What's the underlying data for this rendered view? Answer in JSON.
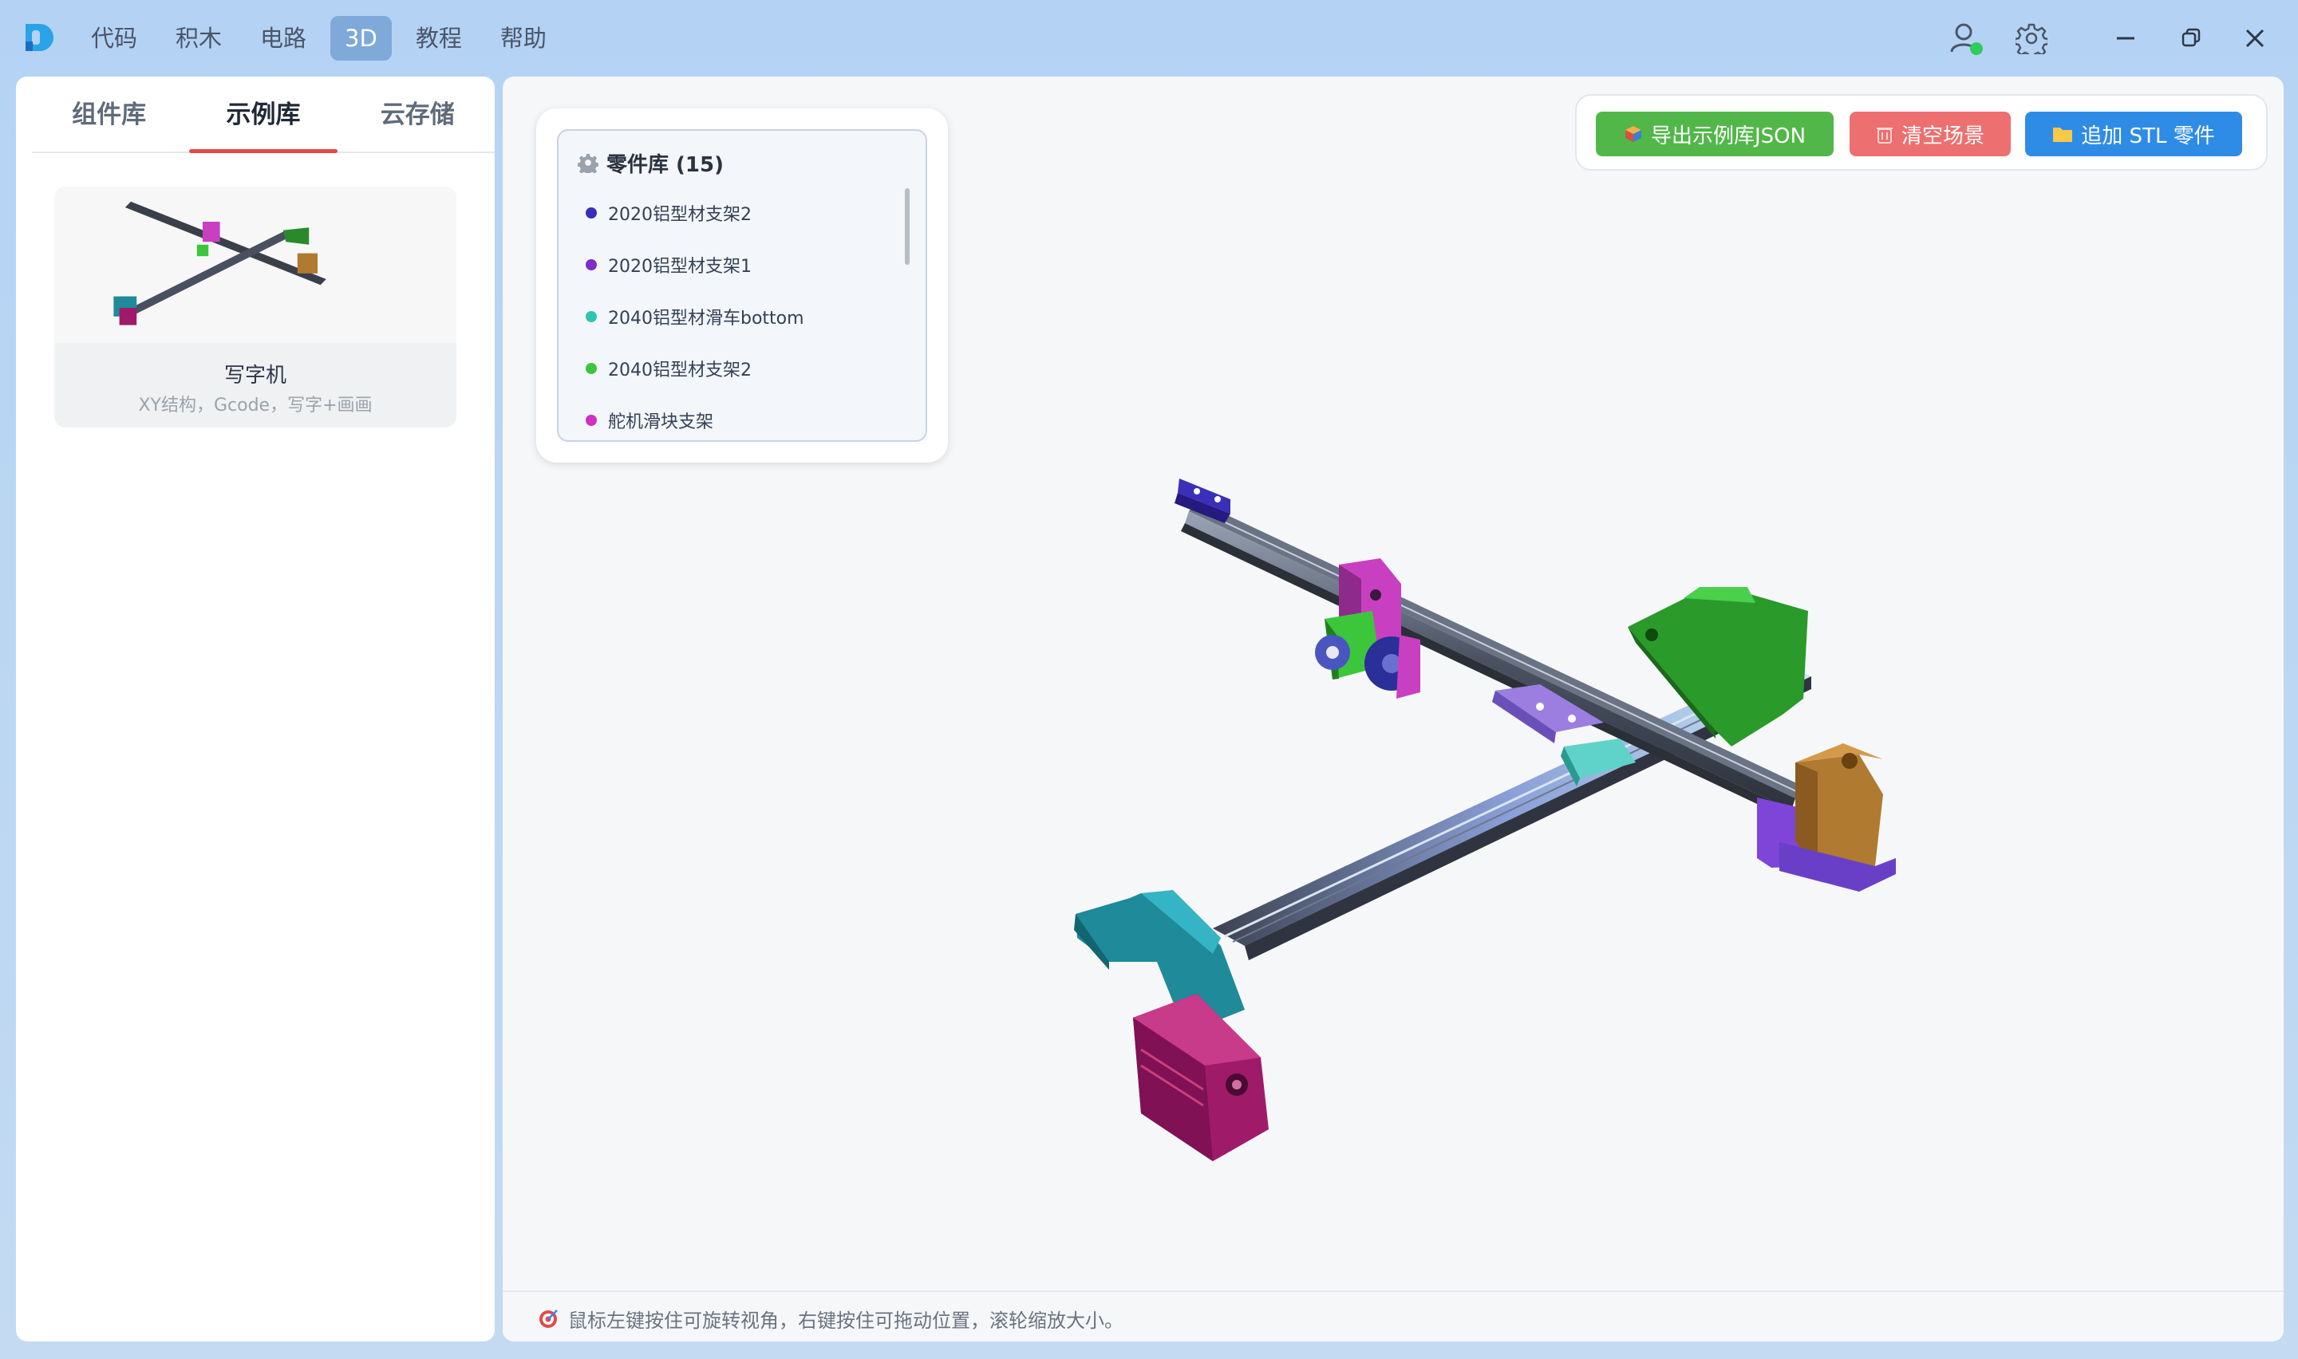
{
  "menu": {
    "items": [
      "代码",
      "积木",
      "电路",
      "3D",
      "教程",
      "帮助"
    ],
    "active": "3D"
  },
  "colors": {
    "accent": "#7fa9d9",
    "online": "#2ecc5b",
    "tab_underline": "#e24a4a",
    "export_button": "#52b749",
    "clear_button": "#ee6f6f",
    "add_stl_button": "#2f8ce6"
  },
  "header_icons": [
    "user-online-icon",
    "gear-icon",
    "minimize-icon",
    "restore-icon",
    "close-icon"
  ],
  "left_panel": {
    "tabs": [
      "组件库",
      "示例库",
      "云存储"
    ],
    "active_tab": "示例库",
    "examples": [
      {
        "title": "写字机",
        "description": "XY结构，Gcode，写字+画画"
      }
    ]
  },
  "parts_panel": {
    "title": "零件库 (15)",
    "items": [
      {
        "name": "2020铝型材支架2",
        "color": "#3a2fb8"
      },
      {
        "name": "2020铝型材支架1",
        "color": "#7a2fc8"
      },
      {
        "name": "2040铝型材滑车bottom",
        "color": "#2ec4b0"
      },
      {
        "name": "2040铝型材支架2",
        "color": "#3cc63c"
      },
      {
        "name": "舵机滑块支架",
        "color": "#d02fc0"
      }
    ]
  },
  "toolbar": {
    "export_label": "导出示例库JSON",
    "clear_label": "清空场景",
    "add_stl_label": "追加 STL 零件"
  },
  "status": {
    "hint": "鼠标左键按住可旋转视角，右键按住可拖动位置，滚轮缩放大小。"
  }
}
